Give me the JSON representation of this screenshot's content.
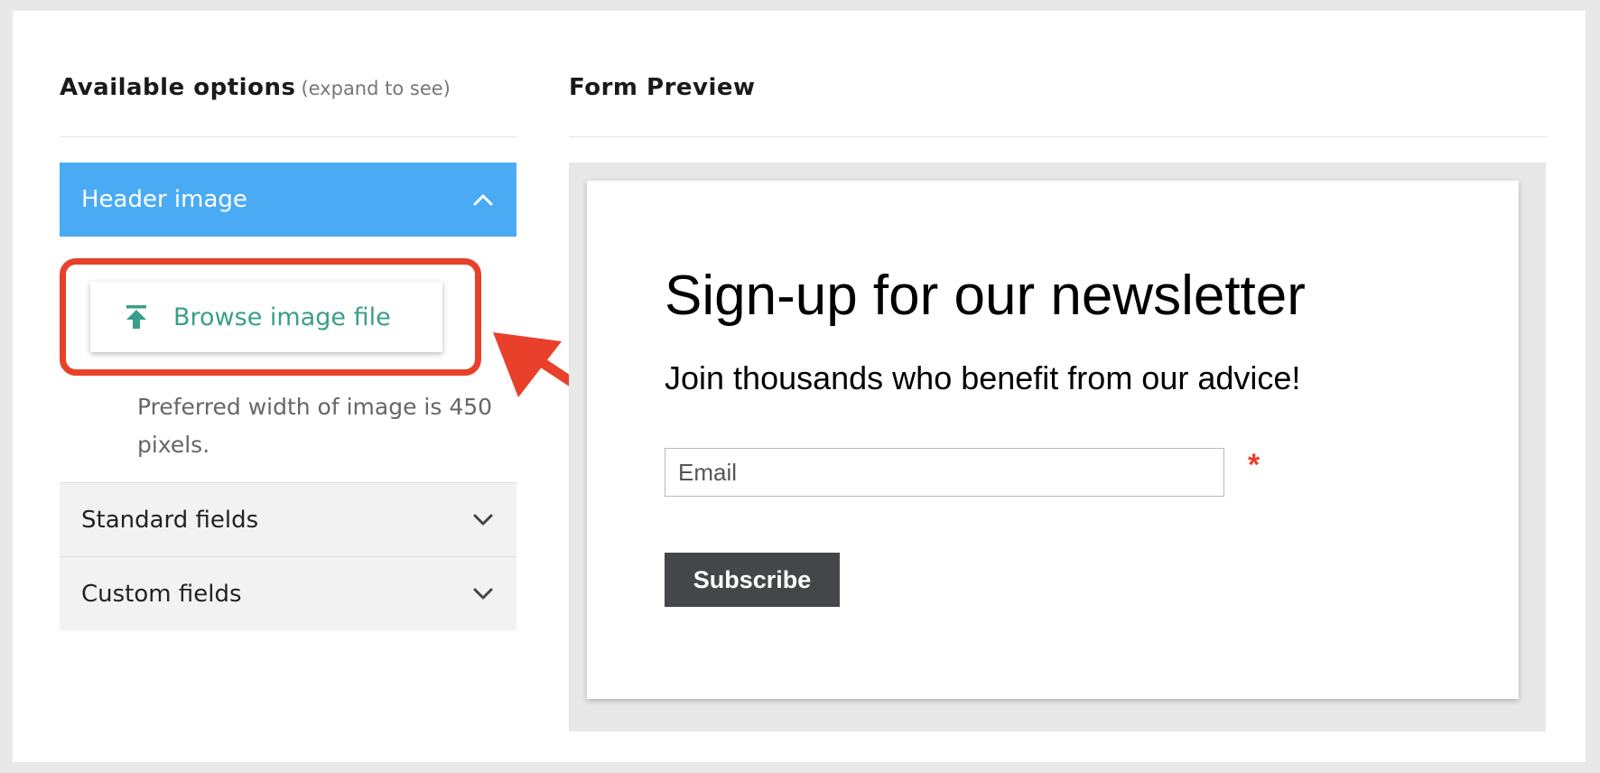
{
  "left_panel": {
    "title": "Available options",
    "hint": "(expand to see)",
    "sections": [
      {
        "label": "Header image",
        "expanded": true
      },
      {
        "label": "Standard fields",
        "expanded": false
      },
      {
        "label": "Custom fields",
        "expanded": false
      }
    ],
    "browse_button_label": "Browse image file",
    "preferred_width_note": "Preferred width of image is 450 pixels."
  },
  "right_panel": {
    "title": "Form Preview",
    "form": {
      "heading": "Sign-up for our newsletter",
      "subheading": "Join thousands who benefit from our advice!",
      "email_placeholder": "Email",
      "required_marker": "*",
      "submit_label": "Subscribe"
    }
  },
  "colors": {
    "accent_blue": "#4aabf4",
    "highlight_red": "#e8402a",
    "browse_text": "#3a9e88",
    "button_dark": "#45464a"
  },
  "icons": [
    "chevron-up-icon",
    "chevron-down-icon",
    "upload-icon",
    "annotation-arrow"
  ]
}
